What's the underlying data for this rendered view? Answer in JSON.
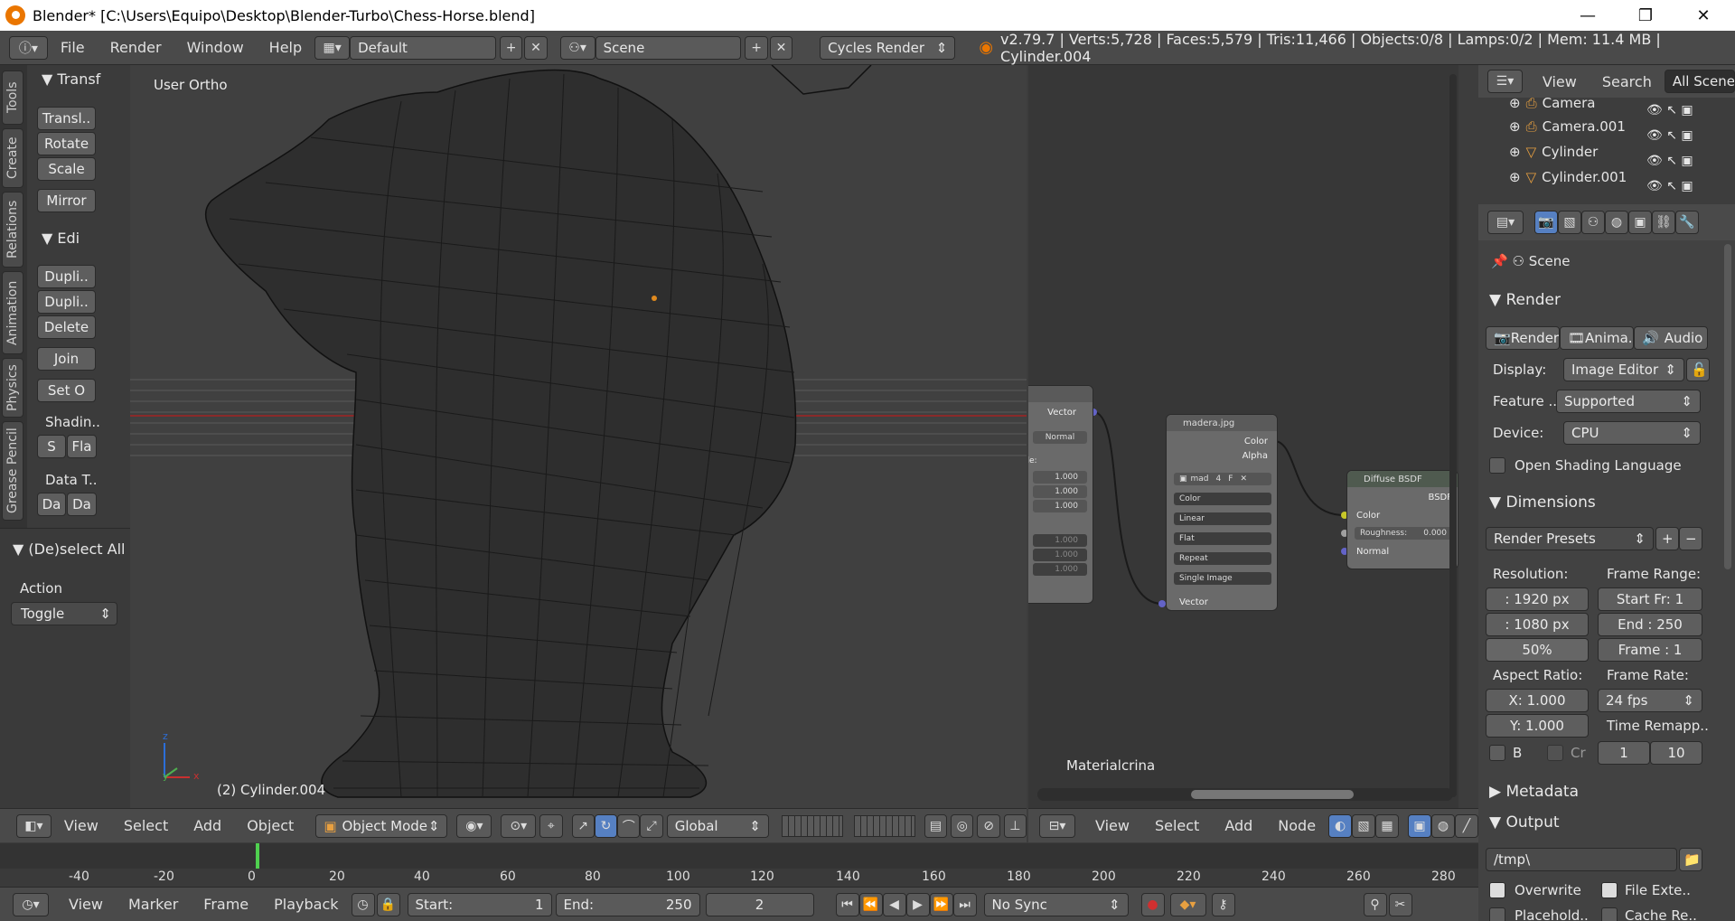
{
  "window": {
    "title": "Blender* [C:\\Users\\Equipo\\Desktop\\Blender-Turbo\\Chess-Horse.blend]",
    "minimize": "—",
    "maximize": "❐",
    "close": "✕"
  },
  "menu": {
    "items": [
      "File",
      "Render",
      "Window",
      "Help"
    ],
    "layout": "Default",
    "scene": "Scene",
    "engine": "Cycles Render",
    "stats": "v2.79.7 | Verts:5,728 | Faces:5,579 | Tris:11,466 | Objects:0/8 | Lamps:0/2 | Mem: 11.4 MB | Cylinder.004"
  },
  "tools": {
    "tabs": [
      "Tools",
      "Create",
      "Relations",
      "Animation",
      "Physics",
      "Grease Pencil"
    ],
    "transform_header": "Transf",
    "transform": [
      "Transl..",
      "Rotate",
      "Scale",
      "Mirror"
    ],
    "edit_header": "Edi",
    "edit": [
      "Dupli..",
      "Dupli..",
      "Delete",
      "Join",
      "Set O"
    ],
    "shading_label": "Shadin..",
    "shading": [
      "S",
      "Fla"
    ],
    "data_label": "Data T..",
    "data": [
      "Da",
      "Da"
    ],
    "op_header": "(De)select All",
    "action_label": "Action",
    "action_value": "Toggle"
  },
  "viewport": {
    "view_label": "User Ortho",
    "object_label": "(2) Cylinder.004",
    "axis_z": "z",
    "axis_y": "y",
    "axis_x": "x"
  },
  "view3d_header": {
    "items": [
      "View",
      "Select",
      "Add",
      "Object"
    ],
    "mode": "Object Mode",
    "orientation": "Global"
  },
  "node_editor": {
    "material": "Materialcrina",
    "header": [
      "View",
      "Select",
      "Add",
      "Node"
    ],
    "mapping": {
      "vector_out": "Vector",
      "type": "Normal",
      "vals": [
        "1.000",
        "1.000",
        "1.000"
      ],
      "vals2": [
        "1.000",
        "1.000",
        "1.000"
      ],
      "label": "ale:"
    },
    "image": {
      "title": "madera.jpg",
      "out_color": "Color",
      "out_alpha": "Alpha",
      "img": "mad",
      "num": "4",
      "f": "F",
      "opts": [
        "Color",
        "Linear",
        "Flat",
        "Repeat",
        "Single Image"
      ],
      "in_vector": "Vector"
    },
    "diffuse": {
      "title": "Diffuse BSDF",
      "out": "BSDF",
      "in_color": "Color",
      "roughness": "Roughness:",
      "roughness_val": "0.000",
      "in_normal": "Normal"
    }
  },
  "outliner": {
    "header": [
      "View",
      "Search"
    ],
    "filter": "All Scenes",
    "items": [
      "Camera",
      "Camera.001",
      "Cylinder",
      "Cylinder.001"
    ]
  },
  "properties": {
    "scene": "Scene",
    "render_header": "Render",
    "render_buttons": [
      "Render",
      "Anima..",
      "Audio"
    ],
    "display_label": "Display:",
    "display": "Image Editor",
    "feature_label": "Feature ..",
    "feature": "Supported",
    "device_label": "Device:",
    "device": "CPU",
    "osl": "Open Shading Language",
    "dimensions_header": "Dimensions",
    "presets": "Render Presets",
    "resolution_label": "Resolution:",
    "res_x": ": 1920 px",
    "res_y": ": 1080 px",
    "res_pct": "50%",
    "frame_range_label": "Frame Range:",
    "start": "Start Fr: 1",
    "end": "End : 250",
    "frame": "Frame : 1",
    "aspect_label": "Aspect Ratio:",
    "aspect_x": "X:  1.000",
    "aspect_y": "Y:  1.000",
    "frame_rate_label": "Frame Rate:",
    "fps": "24 fps",
    "remap_label": "Time Remapp..",
    "remap_old": "1",
    "remap_new": "10",
    "border": "B",
    "crop": "Cr",
    "metadata_header": "Metadata",
    "output_header": "Output",
    "output_path": "/tmp\\",
    "overwrite": "Overwrite",
    "file_ext": "File Exte..",
    "placeholders": "Placehold..",
    "cache": "Cache Re.."
  },
  "timeline": {
    "ticks": [
      "-40",
      "-20",
      "0",
      "20",
      "40",
      "60",
      "80",
      "100",
      "120",
      "140",
      "160",
      "180",
      "200",
      "220",
      "240",
      "260",
      "280"
    ],
    "header": [
      "View",
      "Marker",
      "Frame",
      "Playback"
    ],
    "start": "Start:",
    "start_val": "1",
    "end": "End:",
    "end_val": "250",
    "current": "2",
    "sync": "No Sync"
  }
}
